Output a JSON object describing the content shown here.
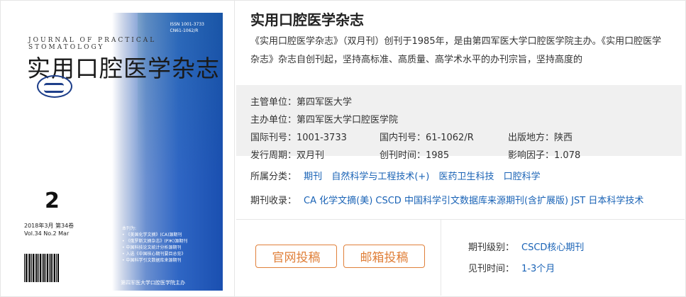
{
  "cover": {
    "en_title": "JOURNAL OF PRACTICAL STOMATOLOGY",
    "cn_title": "实用口腔医学杂志",
    "issn": "ISSN 1001-3733",
    "cn_code": "CN61-1062/R",
    "issue_number": "2",
    "date_line1": "2018年3月   第34卷",
    "date_line2": "Vol.34 No.2 Mar",
    "barcode_text": "ISSN 1001-3733",
    "index_list": [
      "本刊为:",
      "• 《美国化学文摘》(CA)源期刊",
      "• 《俄罗斯文摘杂志》(PЖ)源期刊",
      "• 中国科技论文统计分析源期刊",
      "• 入选《中国核心期刊要目总览》",
      "• 中国科学引文数据库来源期刊"
    ],
    "publisher": "第四军医大学口腔医学院主办"
  },
  "journal": {
    "title": "实用口腔医学杂志",
    "description": "《实用口腔医学杂志》（双月刊）创刊于1985年，是由第四军医大学口腔医学院主办。《实用口腔医学杂志》杂志自创刊起，坚持高标准、高质量、高学术水平的办刊宗旨，坚持高度的"
  },
  "meta": {
    "supervisor_label": "主管单位：",
    "supervisor": "第四军医大学",
    "sponsor_label": "主办单位：",
    "sponsor": "第四军医大学口腔医学院",
    "issn_label": "国际刊号：",
    "issn": "1001-3733",
    "cn_label": "国内刊号：",
    "cn": "61-1062/R",
    "place_label": "出版地方：",
    "place": "陕西",
    "cycle_label": "发行周期：",
    "cycle": "双月刊",
    "founded_label": "创刊时间：",
    "founded": "1985",
    "impact_label": "影响因子：",
    "impact": "1.078"
  },
  "category": {
    "label": "所属分类：",
    "items": [
      "期刊",
      "自然科学与工程技术(+)",
      "医药卫生科技",
      "口腔科学"
    ]
  },
  "indexing": {
    "label": "期刊收录：",
    "value": "CA 化学文摘(美) CSCD 中国科学引文数据库来源期刊(含扩展版) JST 日本科学技术"
  },
  "actions": {
    "official_submit": "官网投稿",
    "email_submit": "邮箱投稿"
  },
  "level": {
    "label": "期刊级别：",
    "value": "CSCD核心期刊"
  },
  "publish_time": {
    "label": "见刊时间：",
    "value": "1-3个月"
  },
  "colors": {
    "link": "#1a63b6",
    "button": "#e0803a",
    "meta_bg": "#f0f0f0"
  }
}
